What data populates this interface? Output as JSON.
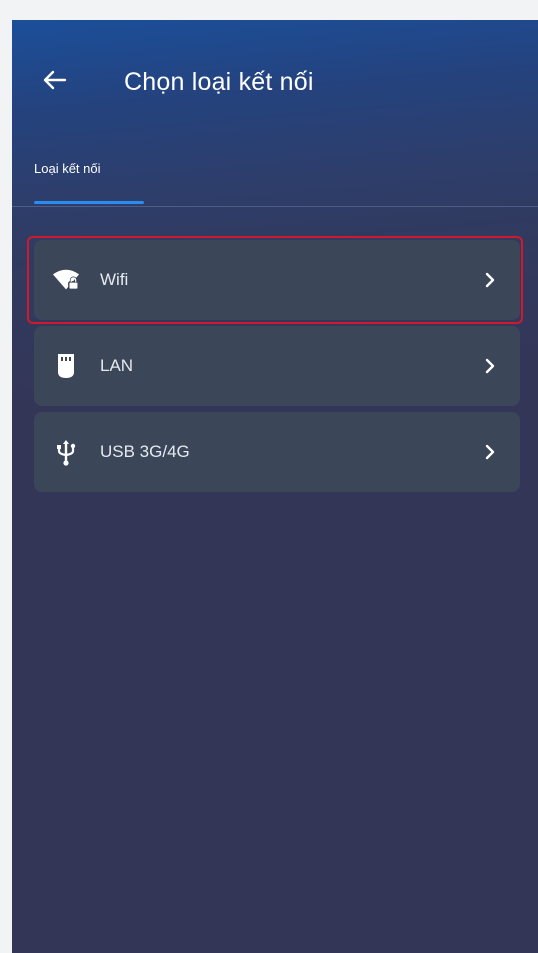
{
  "header": {
    "back_icon": "arrow-left-icon",
    "title": "Chọn loại kết nối"
  },
  "tabs": [
    {
      "label": "Loại kết nối",
      "active": true
    }
  ],
  "connection_types": [
    {
      "label": "Wifi",
      "icon": "wifi-lock-icon",
      "highlighted": true
    },
    {
      "label": "LAN",
      "icon": "ethernet-icon",
      "highlighted": false
    },
    {
      "label": "USB 3G/4G",
      "icon": "usb-icon",
      "highlighted": false
    }
  ],
  "colors": {
    "accent": "#2a8cf0",
    "highlight_border": "#d0192c",
    "item_bg": "#3b4659",
    "screen_bg": "#343657"
  }
}
